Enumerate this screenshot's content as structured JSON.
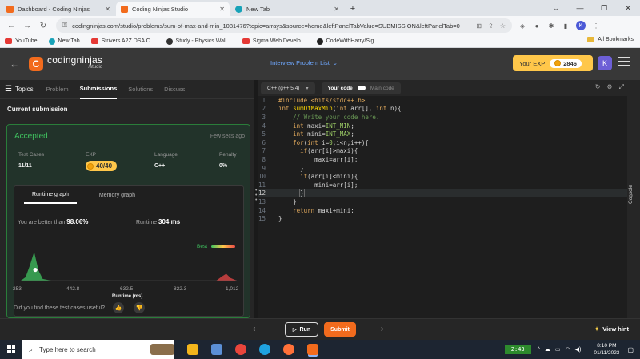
{
  "browser": {
    "tabs": [
      {
        "title": "Dashboard - Coding Ninjas",
        "color": "#f26b1d",
        "active": false
      },
      {
        "title": "Coding Ninjas Studio",
        "color": "#f26b1d",
        "active": true
      },
      {
        "title": "New Tab",
        "color": "#17a2b8",
        "active": false
      }
    ],
    "url": "codingninjas.com/studio/problems/sum-of-max-and-min_1081476?topic=arrays&source=home&leftPanelTabValue=SUBMISSION&leftPanelTab=0",
    "profile_initial": "K",
    "bookmarks": [
      {
        "label": "YouTube",
        "color": "#e53935"
      },
      {
        "label": "New Tab",
        "color": "#17a2b8"
      },
      {
        "label": "Strivers A2Z DSA C...",
        "color": "#e53935"
      },
      {
        "label": "Study - Physics Wall...",
        "color": "#333333"
      },
      {
        "label": "Sigma Web Develo...",
        "color": "#e53935"
      },
      {
        "label": "CodeWithHarry/Sig...",
        "color": "#222222"
      }
    ],
    "all_bookmarks": "All Bookmarks"
  },
  "header": {
    "brand": "codingninjas",
    "brand_sub": "/studio",
    "problem_list": "Interview Problem List",
    "your_exp_label": "Your EXP",
    "exp_value": "2846",
    "user_initial": "K"
  },
  "left_tabs": {
    "topics": "Topics",
    "items": [
      "Problem",
      "Submissions",
      "Solutions",
      "Discuss"
    ],
    "active": "Submissions"
  },
  "submission": {
    "heading": "Current submission",
    "status": "Accepted",
    "time": "Few secs ago",
    "stats": [
      {
        "label": "Test Cases",
        "value": "11/11"
      },
      {
        "label": "EXP",
        "value": "40/40"
      },
      {
        "label": "Language",
        "value": "C++"
      },
      {
        "label": "Penalty",
        "value": "0%"
      }
    ],
    "graph_tabs": [
      "Runtime graph",
      "Memory graph"
    ],
    "better_prefix": "You are better than",
    "better_value": "98.06%",
    "runtime_label": "Runtime",
    "runtime_value": "304 ms",
    "best_label": "Best",
    "x_ticks": [
      "253",
      "442.8",
      "632.5",
      "822.3",
      "1,012"
    ],
    "x_title": "Runtime (ms)",
    "useful_question": "Did you find these test cases useful?"
  },
  "editor": {
    "language": "C++ (g++ 5.4)",
    "your_code": "Your code",
    "main_code": "Main code",
    "current_line": 12
  },
  "bottom": {
    "run": "Run",
    "submit": "Submit",
    "view_hint": "View hint",
    "console": "Console"
  },
  "taskbar": {
    "search_placeholder": "Type here to search",
    "counter": "2:43",
    "time": "8:10 PM",
    "date": "01/11/2023"
  },
  "chart_data": {
    "type": "area",
    "x": [
      253,
      270,
      285,
      300,
      315,
      330,
      360,
      400,
      600,
      800,
      940,
      960,
      975,
      990,
      1012
    ],
    "series": [
      {
        "values": [
          0,
          4,
          18,
          34,
          12,
          2,
          0,
          0,
          0,
          0,
          0,
          5,
          8,
          3,
          0
        ]
      }
    ],
    "highlight_x": 304,
    "xlim": [
      253,
      1012
    ],
    "xlabel": "Runtime (ms)",
    "x_ticks": [
      253,
      442.8,
      632.5,
      822.3,
      1012
    ],
    "colors": {
      "fast": "#3fc25f",
      "slow": "#e94646"
    }
  }
}
